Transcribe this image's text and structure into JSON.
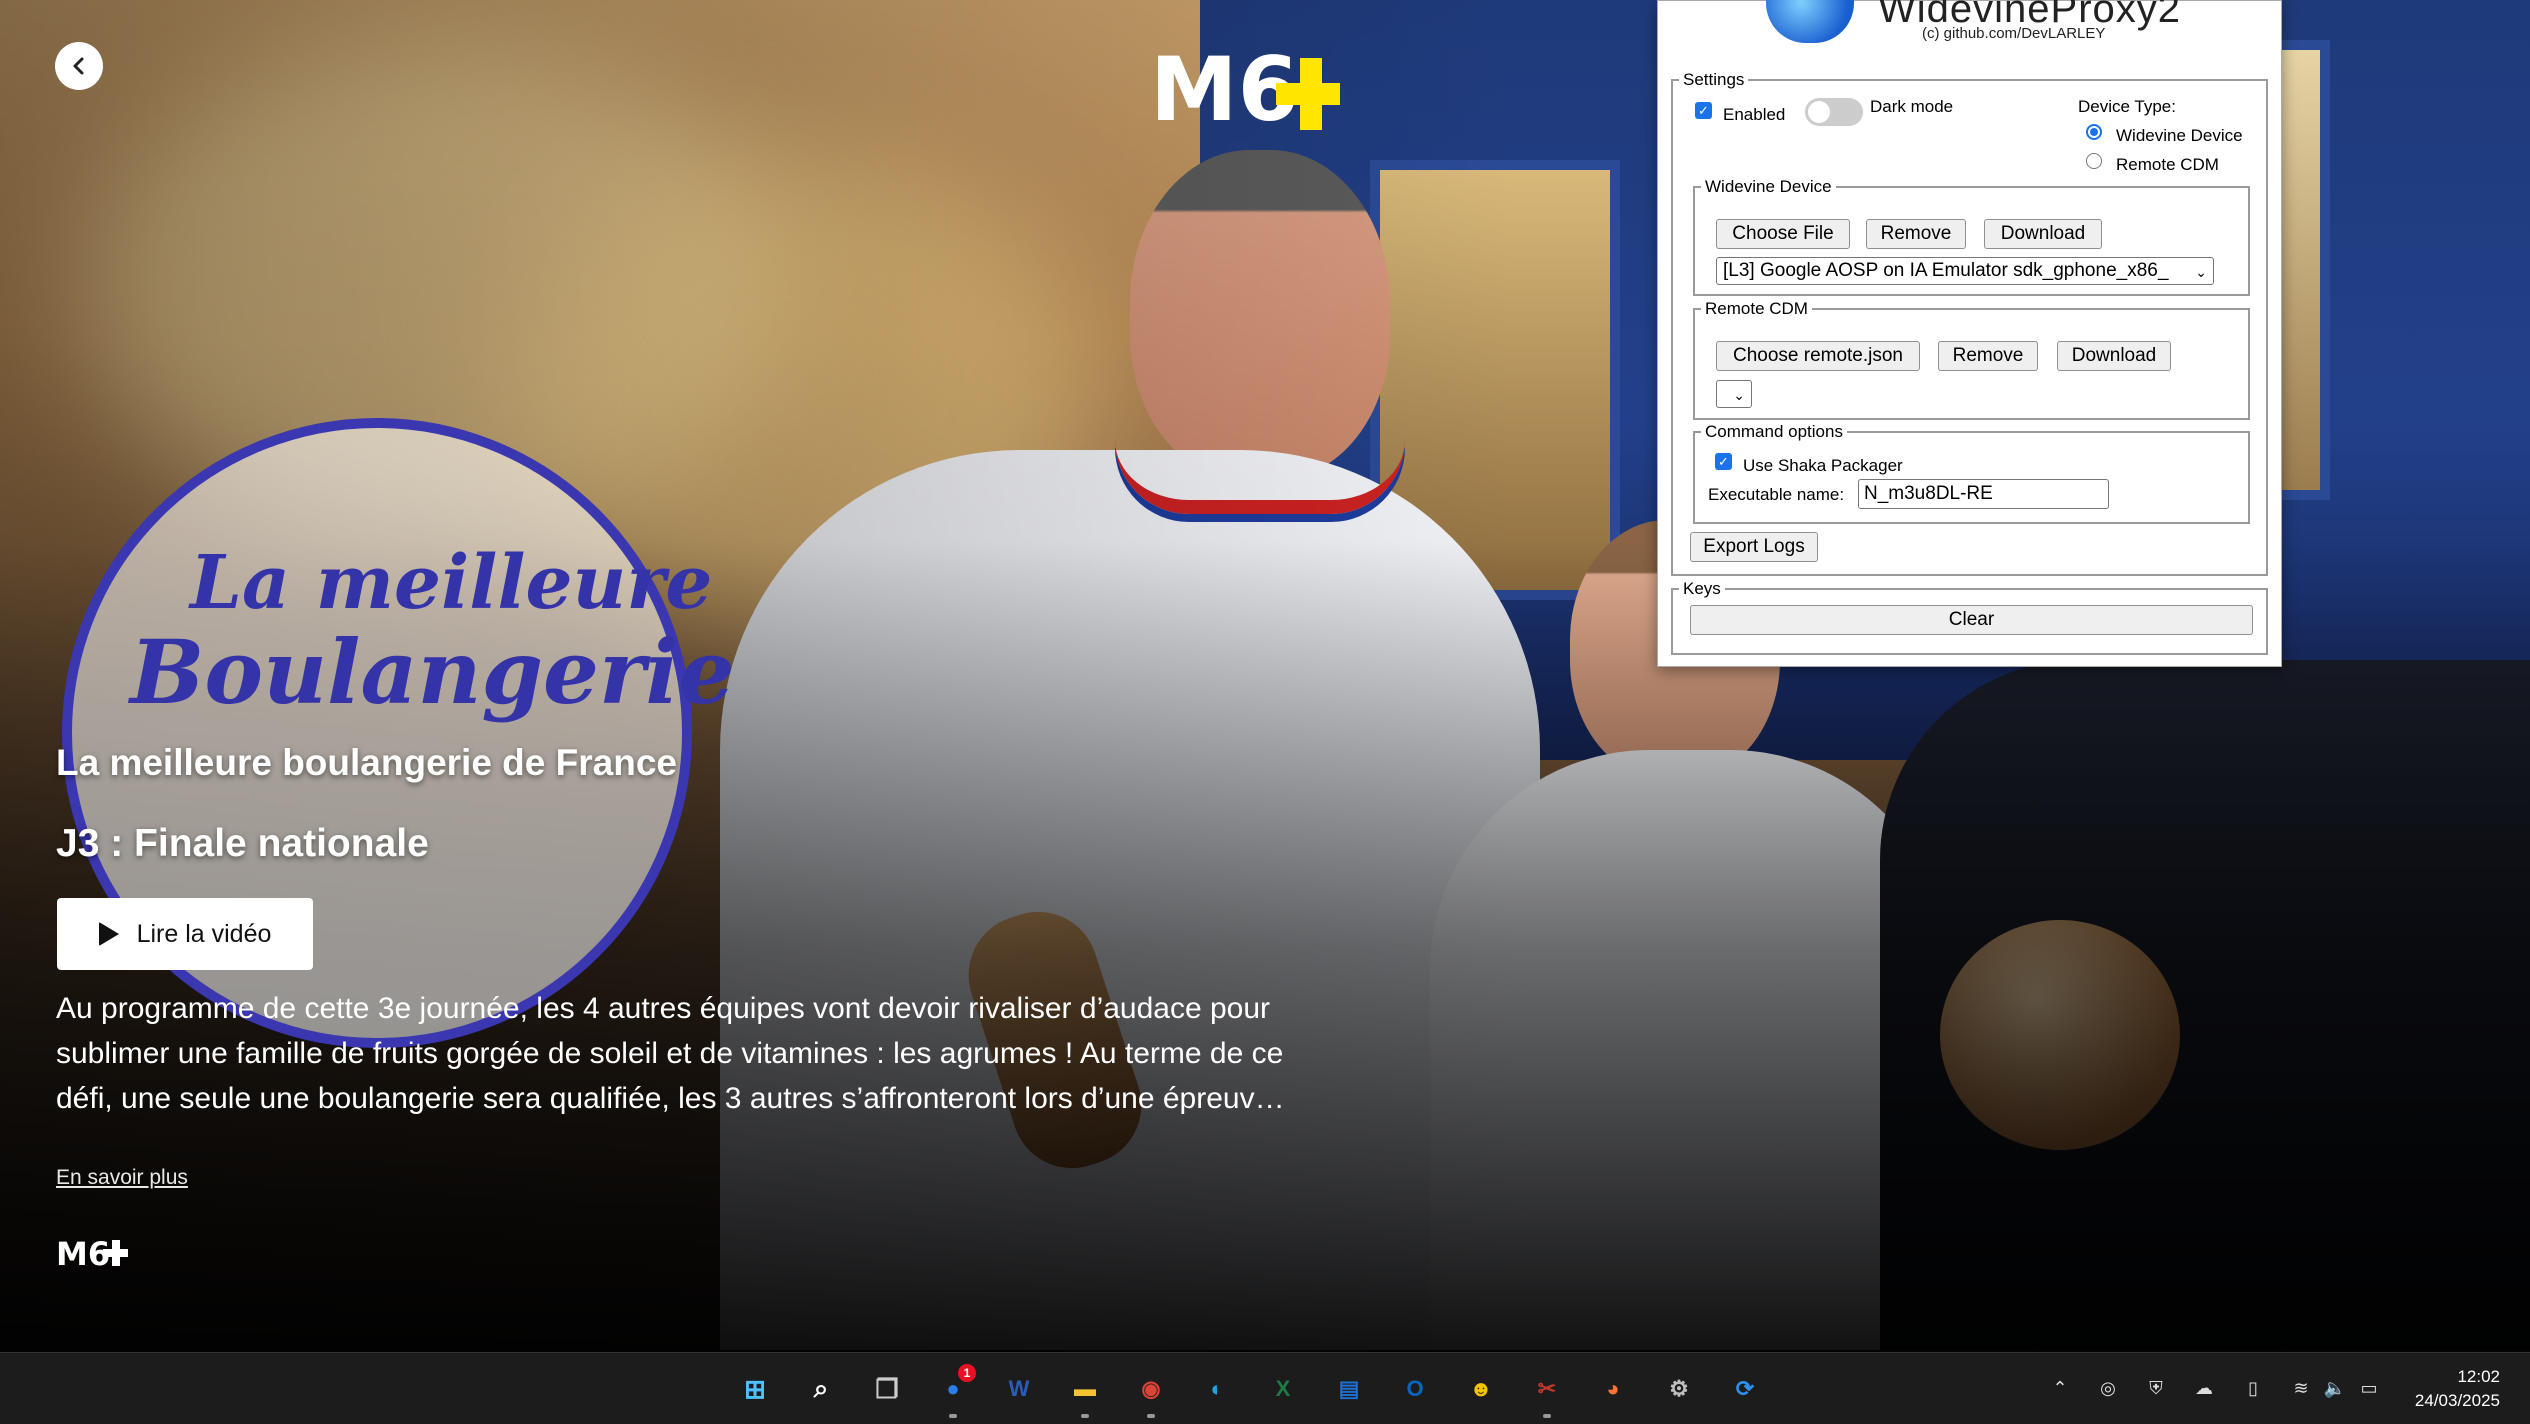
{
  "hero": {
    "back_label": "‹",
    "channel_logo": "M6+",
    "badge_line1": "La meilleure",
    "badge_line2": "Boulangerie",
    "show_title": "La meilleure boulangerie de France",
    "episode_title": "J3 : Finale nationale",
    "play_label": "Lire la vidéo",
    "description": "Au programme de cette 3e journée, les 4 autres équipes vont devoir rivaliser d’audace pour sublimer une famille de fruits gorgée de soleil et de vitamines : les agrumes ! Au terme de ce défi, une seule une boulangerie sera qualifiée, les 3 autres s’affronteront lors d’une épreuv…",
    "more_label": "En savoir plus",
    "footer_logo": "M6+",
    "accent": "#ffe600"
  },
  "extension": {
    "title": "WidevineProxy2",
    "subtitle": "(c) github.com/DevLARLEY",
    "settings": {
      "legend": "Settings",
      "enabled_label": "Enabled",
      "enabled": true,
      "dark_mode_label": "Dark mode",
      "dark_mode": false,
      "device_type_label": "Device Type:",
      "device_options": [
        "Widevine Device",
        "Remote CDM"
      ],
      "selected_device": "Widevine Device"
    },
    "widevine_device": {
      "legend": "Widevine Device",
      "choose_label": "Choose File",
      "remove_label": "Remove",
      "download_label": "Download",
      "selected": "[L3] Google AOSP on IA Emulator sdk_gphone_x86_"
    },
    "remote_cdm": {
      "legend": "Remote CDM",
      "choose_label": "Choose remote.json",
      "remove_label": "Remove",
      "download_label": "Download",
      "selected": ""
    },
    "command_options": {
      "legend": "Command options",
      "shaka_label": "Use Shaka Packager",
      "shaka": true,
      "exec_label": "Executable name:",
      "exec_value": "N_m3u8DL-RE"
    },
    "export_label": "Export Logs",
    "keys": {
      "legend": "Keys",
      "clear_label": "Clear"
    }
  },
  "taskbar": {
    "apps": [
      {
        "name": "start-icon",
        "glyph": "⊞",
        "color": "#4cc2ff"
      },
      {
        "name": "search-icon",
        "glyph": "⌕",
        "color": "#ffffff"
      },
      {
        "name": "task-view-icon",
        "glyph": "❐",
        "color": "#cccccc"
      },
      {
        "name": "messenger-icon",
        "glyph": "●",
        "color": "#2b7de9",
        "badge": "1"
      },
      {
        "name": "word-icon",
        "glyph": "W",
        "color": "#2b5cb8"
      },
      {
        "name": "file-explorer-icon",
        "glyph": "▬",
        "color": "#f4c430"
      },
      {
        "name": "chrome-icon",
        "glyph": "◉",
        "color": "#db4437"
      },
      {
        "name": "edge-icon",
        "glyph": "◐",
        "color": "#1fa0e0"
      },
      {
        "name": "excel-icon",
        "glyph": "X",
        "color": "#1f7a45"
      },
      {
        "name": "news-icon",
        "glyph": "▤",
        "color": "#1d6fd1"
      },
      {
        "name": "outlook-icon",
        "glyph": "O",
        "color": "#0a64c2"
      },
      {
        "name": "app-yellow-icon",
        "glyph": "☻",
        "color": "#f5c400"
      },
      {
        "name": "snipping-icon",
        "glyph": "✂",
        "color": "#c0392b"
      },
      {
        "name": "firefox-icon",
        "glyph": "◕",
        "color": "#ff7139"
      },
      {
        "name": "app-tool-icon",
        "glyph": "⚙",
        "color": "#bfbfbf"
      },
      {
        "name": "sync-icon",
        "glyph": "⟳",
        "color": "#2f8ff0"
      }
    ],
    "time": "12:02",
    "date": "24/03/2025"
  }
}
